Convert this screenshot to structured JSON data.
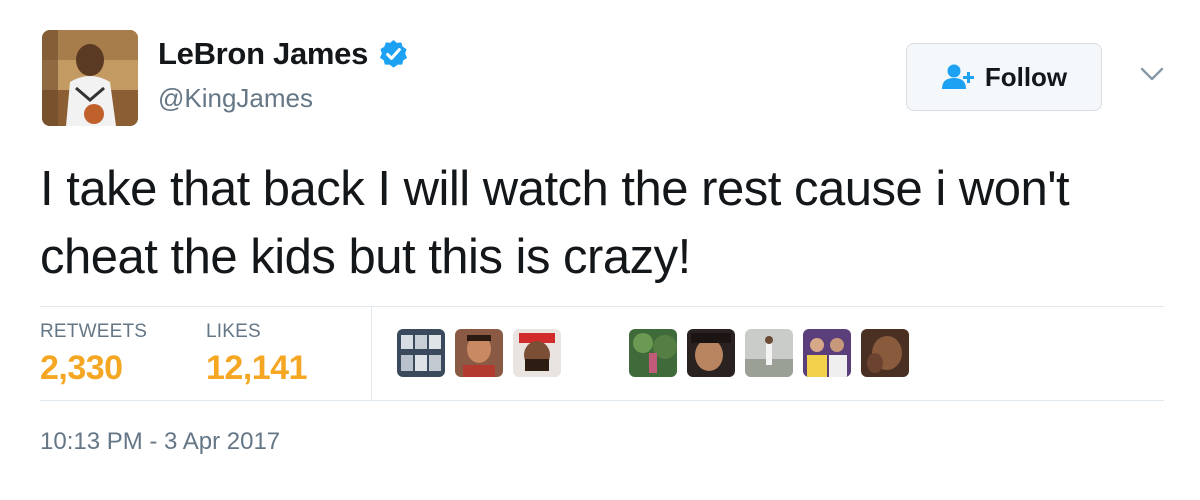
{
  "user": {
    "name": "LeBron James",
    "handle": "@KingJames",
    "verified": true
  },
  "follow_button": {
    "label": "Follow"
  },
  "tweet": {
    "text": "I take that back I will watch the rest cause i won't cheat the kids but this is crazy!"
  },
  "stats": {
    "retweets_label": "RETWEETS",
    "retweets_value": "2,330",
    "likes_label": "LIKES",
    "likes_value": "12,141"
  },
  "timestamp": "10:13 PM - 3 Apr 2017",
  "colors": {
    "stat_value": "#f5a623",
    "verified": "#1da1f2",
    "follow_icon": "#1da1f2",
    "muted": "#657786"
  }
}
